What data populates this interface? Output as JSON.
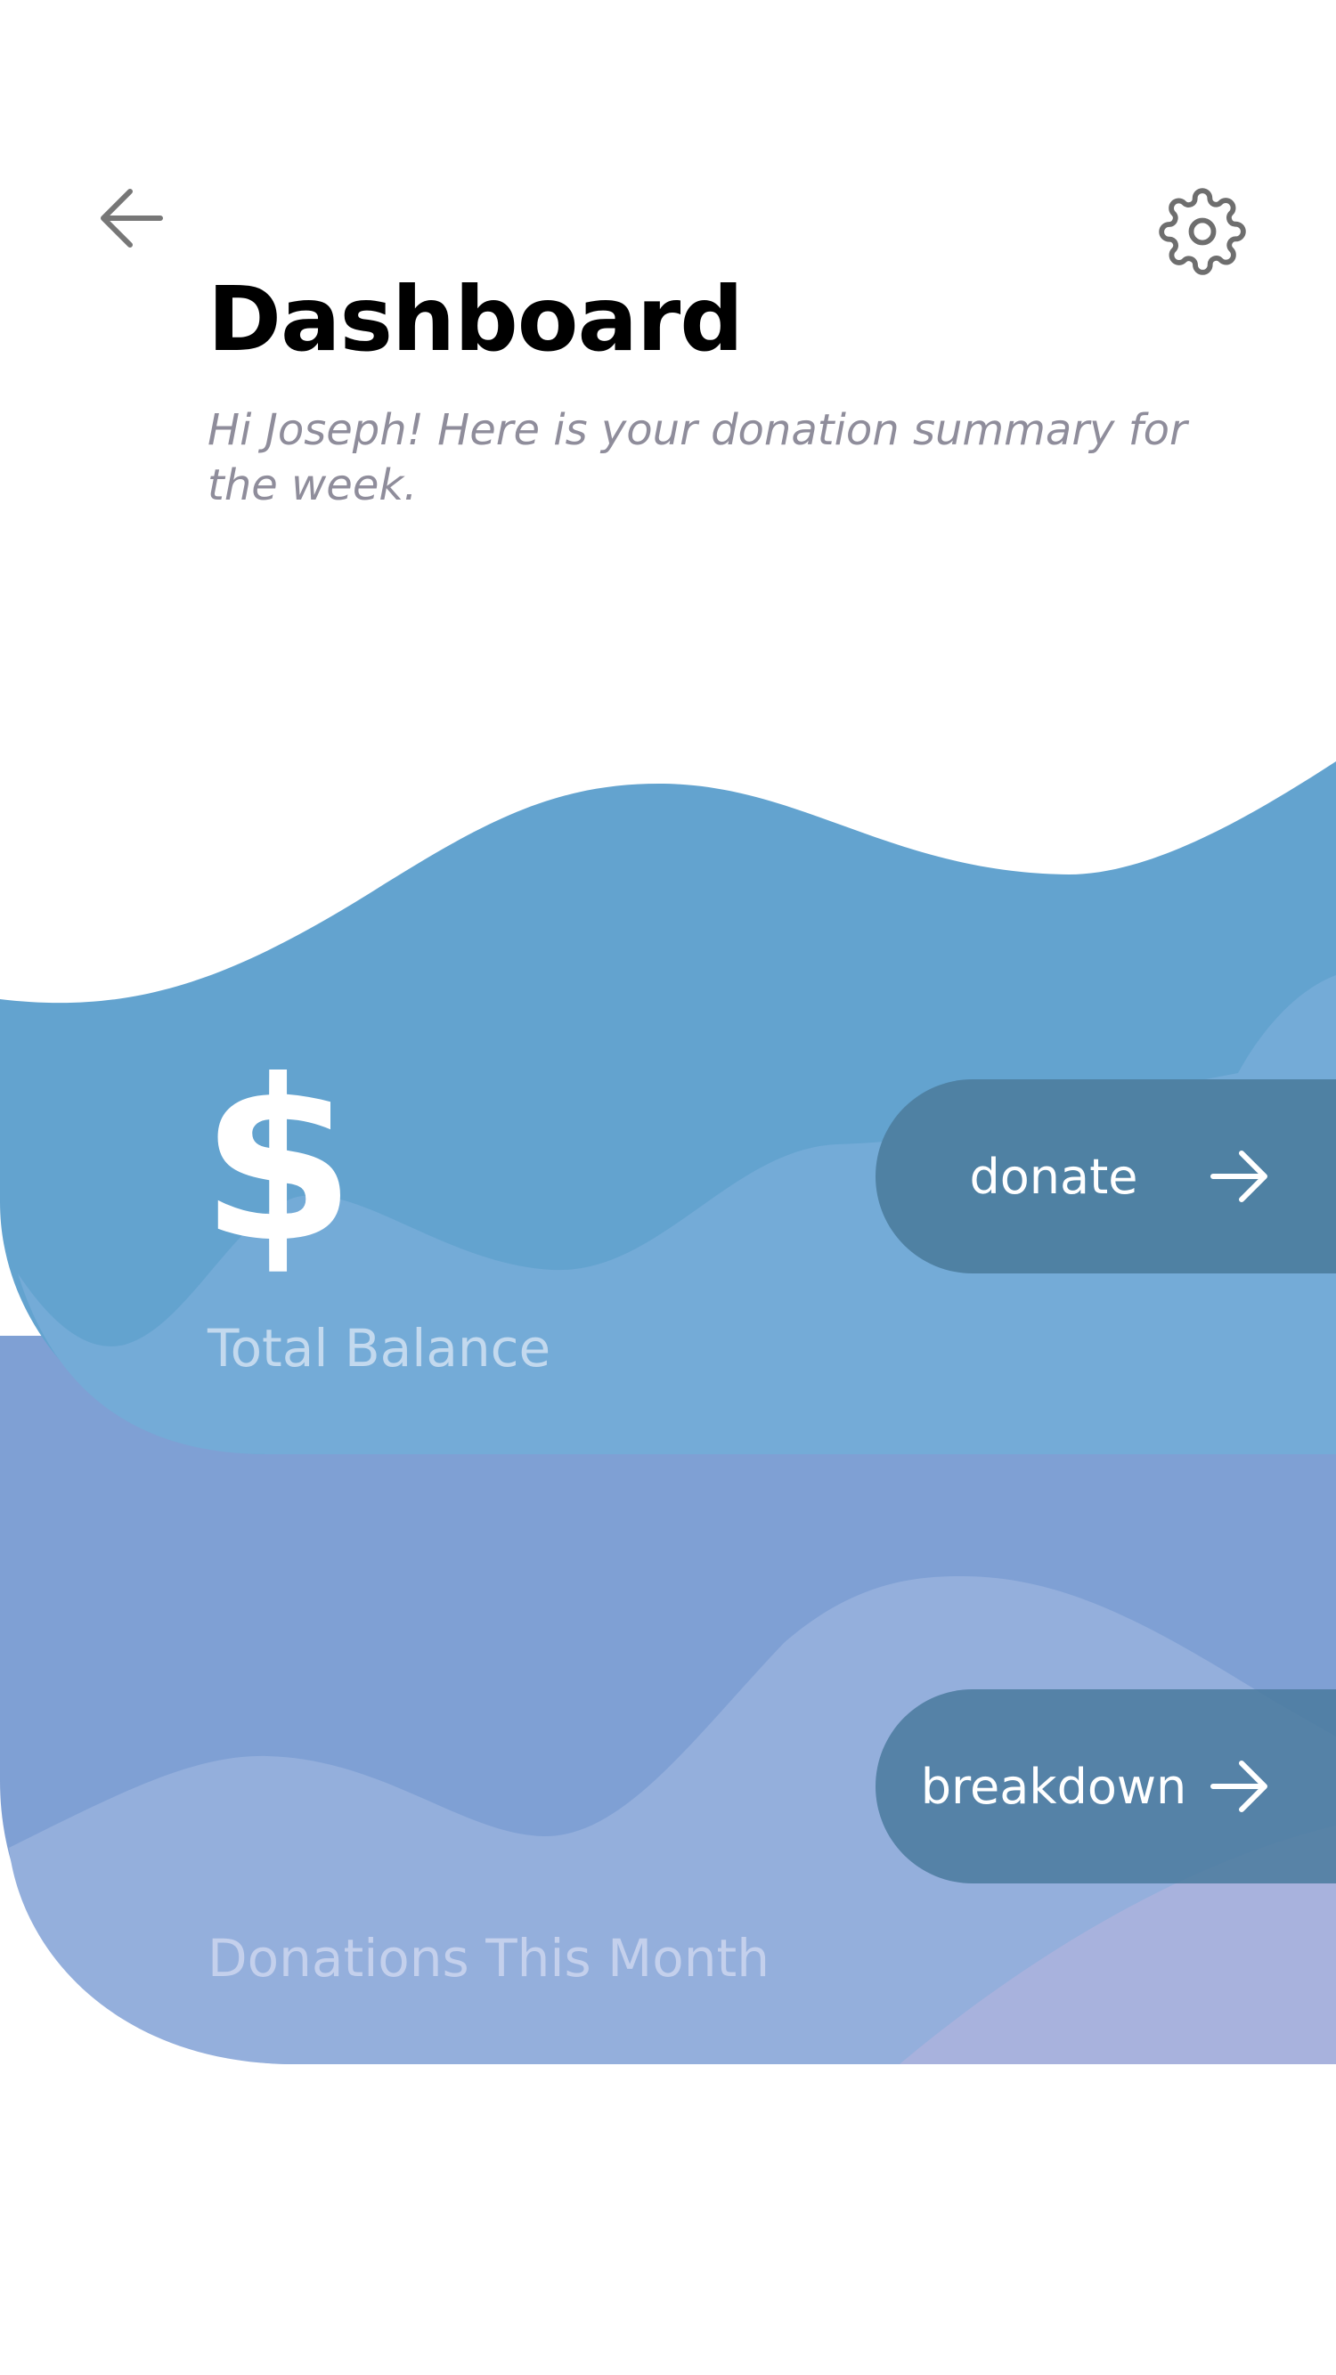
{
  "header": {
    "title": "Dashboard",
    "subtitle": "Hi Joseph! Here is your donation summary for the week.",
    "back_icon": "arrow-left-icon",
    "settings_icon": "gear-icon"
  },
  "balance_card": {
    "symbol": "$",
    "label": "Total Balance",
    "action_label": "donate",
    "action_icon": "arrow-right-icon"
  },
  "donations_card": {
    "label": "Donations This Month",
    "action_label": "breakdown",
    "action_icon": "arrow-right-icon"
  },
  "colors": {
    "balance_wave": "#63a3cf",
    "balance_wave_light": "#74abd7",
    "donations_wave": "#7fa0d4",
    "donations_wave_light": "#94afdc",
    "accent_lavender": "#a8b2dd",
    "button": "#4f81a3"
  }
}
